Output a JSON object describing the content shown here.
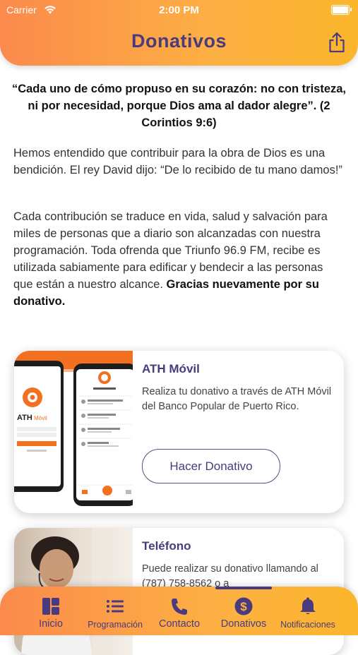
{
  "status_bar": {
    "carrier": "Carrier",
    "time": "2:00 PM"
  },
  "header": {
    "title": "Donativos"
  },
  "quote": "“Cada uno de cómo propuso en su corazón: no con tristeza, ni por necesidad, porque Dios ama al dador alegre”.  (2 Corintios 9:6)",
  "paragraph1": "Hemos entendido que contribuir para la obra de Dios es una bendición. El rey David dijo: “De lo recibido de tu mano damos!”",
  "paragraph2": {
    "text": "Cada contribución se traduce en vida, salud y salvación para miles de personas que a diario son alcanzadas con nuestra programación. Toda ofrenda que Triunfo 96.9 FM, recibe es utilizada sabiamente para edificar y bendecir a las personas que están a nuestro alcance. ",
    "bold": "Gracias nuevamente por su donativo."
  },
  "cards": [
    {
      "title": "ATH Móvil",
      "description": "Realiza tu donativo a través de ATH Móvil del Banco Popular de Puerto Rico.",
      "button": "Hacer Donativo",
      "image_text": {
        "ath": "ATH",
        "movil": "Móvil"
      }
    },
    {
      "title": "Teléfono",
      "description": "Puede realizar su donativo llamando al (787) 758-8562 o a"
    }
  ],
  "tabs": [
    {
      "label": "Inicio",
      "icon": "grid-icon"
    },
    {
      "label": "Programación",
      "icon": "list-icon"
    },
    {
      "label": "Contacto",
      "icon": "phone-icon"
    },
    {
      "label": "Donativos",
      "icon": "dollar-icon",
      "active": true
    },
    {
      "label": "Notificaciones",
      "icon": "bell-icon"
    }
  ],
  "colors": {
    "accent": "#4a3a7e",
    "header_start": "#fb8a4c",
    "header_end": "#fcb62c",
    "ath_orange": "#f37021"
  }
}
